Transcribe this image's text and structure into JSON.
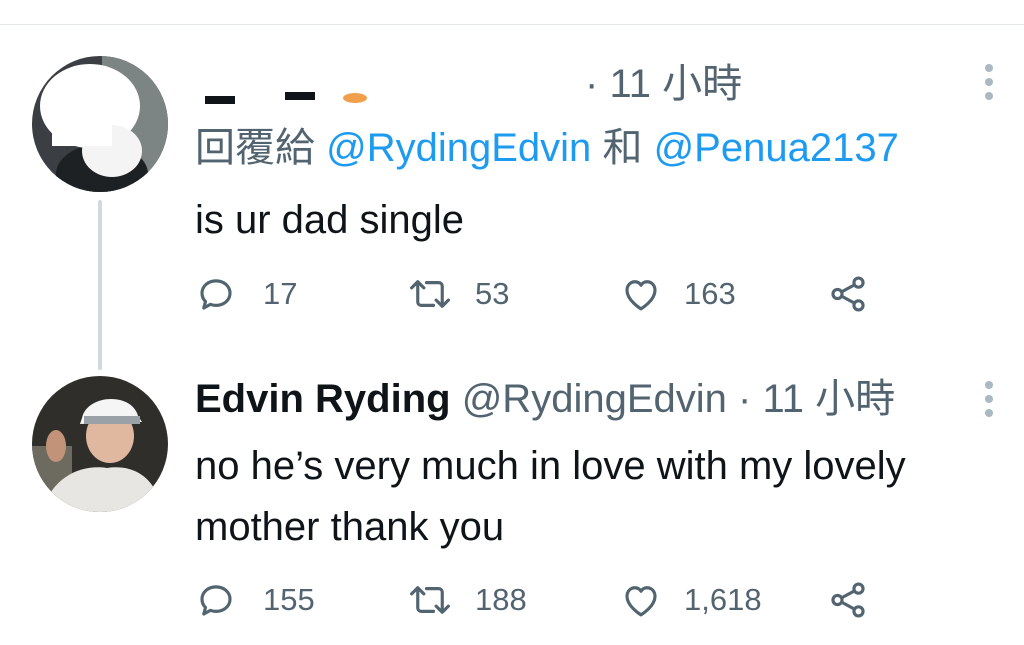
{
  "tweet1": {
    "handle_visible_fragment": "·",
    "time": "11 小時",
    "reply_prefix": "回覆給",
    "reply_handle_1": "@RydingEdvin",
    "reply_conjunction": "和",
    "reply_handle_2": "@Penua2137",
    "text": "is ur dad single",
    "replies": "17",
    "retweets": "53",
    "likes": "163"
  },
  "tweet2": {
    "name": "Edvin Ryding",
    "handle": "@RydingEdvin",
    "separator": "·",
    "time": "11 小時",
    "text": "no he’s very much in love with my lovely mother thank you",
    "replies": "155",
    "retweets": "188",
    "likes": "1,618"
  },
  "icons": {
    "reply": "reply-icon",
    "retweet": "retweet-icon",
    "like": "heart-icon",
    "share": "share-icon",
    "more": "more-options-icon"
  },
  "colors": {
    "link": "#1d9bf0",
    "muted": "#536471",
    "thread_line": "#cfd9de"
  }
}
